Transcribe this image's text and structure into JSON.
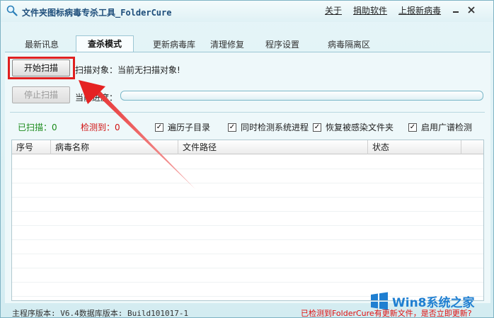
{
  "window": {
    "title": "文件夹图标病毒专杀工具_FolderCure",
    "links": [
      "关于",
      "捐助软件",
      "上报新病毒"
    ],
    "controls": [
      "minimize",
      "close"
    ]
  },
  "tabs": [
    "最新讯息",
    "查杀模式",
    "更新病毒库",
    "清理修复",
    "程序设置",
    "病毒隔离区"
  ],
  "active_tab": "查杀模式",
  "scan": {
    "start_label": "开始扫描",
    "stop_label": "停止扫描",
    "target_label": "扫描对象：",
    "target_value": "当前无扫描对象!",
    "progress_label": "当前进度：",
    "progress_value": 0
  },
  "stats": {
    "scanned_label": "已扫描：",
    "scanned_value": "0",
    "detected_label": "检测到：",
    "detected_value": "0"
  },
  "options": [
    {
      "label": "遍历子目录",
      "checked": true
    },
    {
      "label": "同时检测系统进程",
      "checked": true
    },
    {
      "label": "恢复被感染文件夹",
      "checked": true
    },
    {
      "label": "启用广谱检测",
      "checked": true
    }
  ],
  "table": {
    "columns": [
      "序号",
      "病毒名称",
      "文件路径",
      "状态"
    ],
    "rows": []
  },
  "status": {
    "left": "主程序版本: V6.4数据库版本: Build101017-1",
    "right": "已检测到FolderCure有更新文件，是否立即更新?"
  },
  "watermark": {
    "text": "Win8系统之家"
  },
  "colors": {
    "accent_red": "#e02020",
    "green": "#1a8a1a",
    "red": "#d01010",
    "brand_blue": "#1f7fd1"
  }
}
